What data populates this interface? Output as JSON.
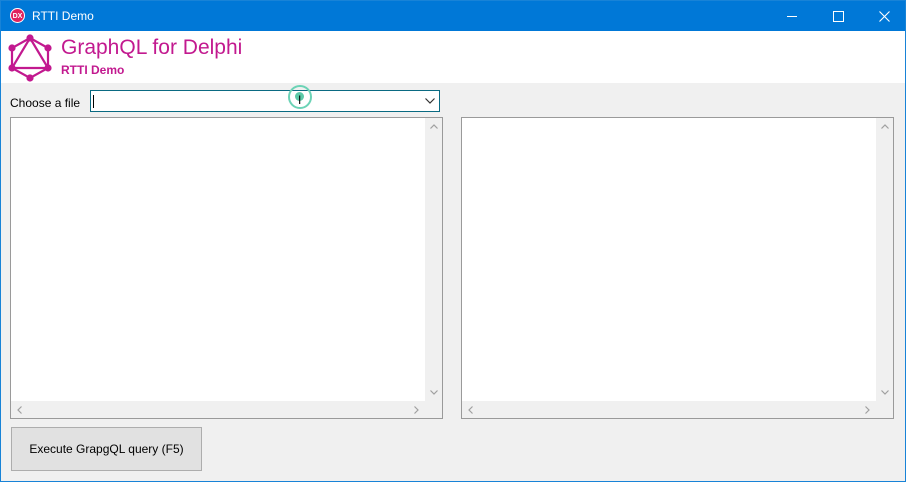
{
  "window": {
    "title": "RTTI Demo",
    "icon_text": "DX"
  },
  "header": {
    "title": "GraphQL for Delphi",
    "subtitle": "RTTI Demo"
  },
  "file_picker": {
    "label": "Choose a file",
    "value": ""
  },
  "actions": {
    "execute_label": "Execute GrapgQL query (F5)"
  },
  "colors": {
    "titlebar": "#0078d7",
    "brand": "#c2198f",
    "focus_border": "#0a6a82"
  },
  "icons": {
    "logo": "graphql-logo-icon",
    "minimize": "minimize-icon",
    "maximize": "maximize-icon",
    "close": "close-icon",
    "dropdown": "chevron-down-icon"
  }
}
